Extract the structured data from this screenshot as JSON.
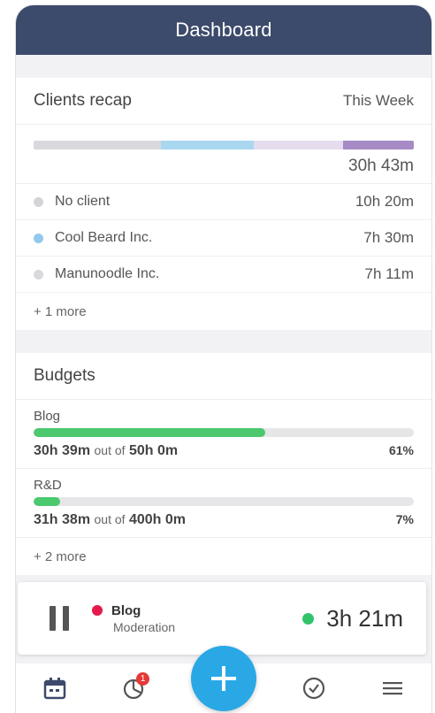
{
  "header": {
    "title": "Dashboard"
  },
  "clients_recap": {
    "title": "Clients recap",
    "period": "This Week",
    "total": "30h 43m",
    "segment_colors": [
      "#d9d9dd",
      "#a9d7f0",
      "#e6dcee",
      "#a78bc6"
    ],
    "clients": [
      {
        "name": "No client",
        "time": "10h 20m",
        "color": "#d4d4d8"
      },
      {
        "name": "Cool Beard Inc.",
        "time": "7h 30m",
        "color": "#92c9ec"
      },
      {
        "name": "Manunoodle Inc.",
        "time": "7h 11m",
        "color": "#d9d9dd"
      }
    ],
    "more": "+ 1 more"
  },
  "budgets": {
    "title": "Budgets",
    "items": [
      {
        "name": "Blog",
        "spent": "30h 39m",
        "of": "out of",
        "total": "50h 0m",
        "percent": "61%",
        "fill": 0.61
      },
      {
        "name": "R&D",
        "spent": "31h 38m",
        "of": "out of",
        "total": "400h 0m",
        "percent": "7%",
        "fill": 0.07
      }
    ],
    "more": "+ 2 more"
  },
  "timer": {
    "project": "Blog",
    "task": "Moderation",
    "elapsed": "3h 21m",
    "project_color": "#e6194b"
  },
  "tabbar": {
    "badge_count": "1",
    "icons": [
      "calendar-icon",
      "chart-icon",
      "plus-icon",
      "check-icon",
      "menu-icon"
    ]
  }
}
